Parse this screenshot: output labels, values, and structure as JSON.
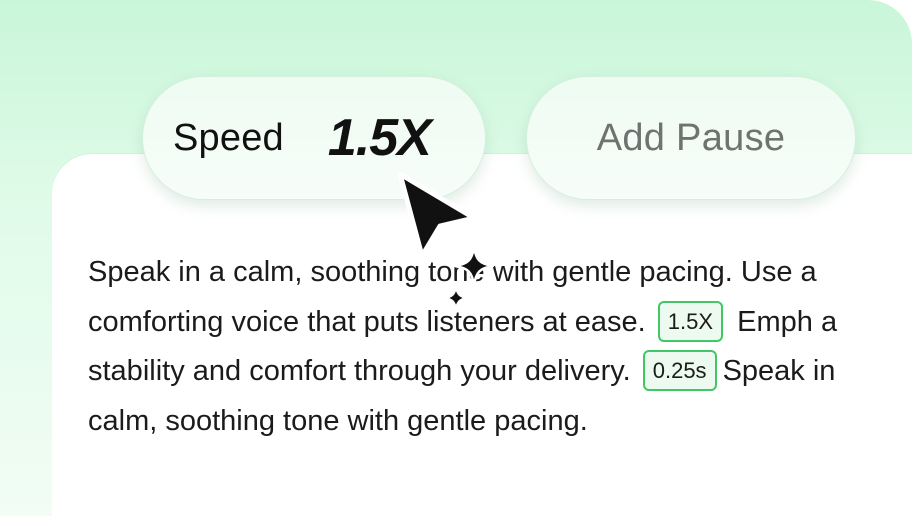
{
  "speed_chip": {
    "label": "Speed",
    "value": "1.5X"
  },
  "pause_chip": {
    "label": "Add Pause"
  },
  "script_text": {
    "line1": "Speak in a calm, soothing tone with gentle pacing. Use a",
    "line2_before": "comforting voice that puts listeners at ease.",
    "speed_tag": "1.5X",
    "line2_after": "Emph  a",
    "line3_before": "stability and comfort through your delivery.",
    "pause_tag": "0.25s",
    "line3_after": "Speak in",
    "line4": "calm, soothing tone with gentle pacing."
  },
  "icons": {
    "cursor": "mouse-pointer-icon",
    "sparkle": "ai-sparkle-icon"
  },
  "colors": {
    "background_gradient_top": "#c9f6d9",
    "tag_border": "#41c765",
    "tag_fill": "#ecfaef"
  }
}
